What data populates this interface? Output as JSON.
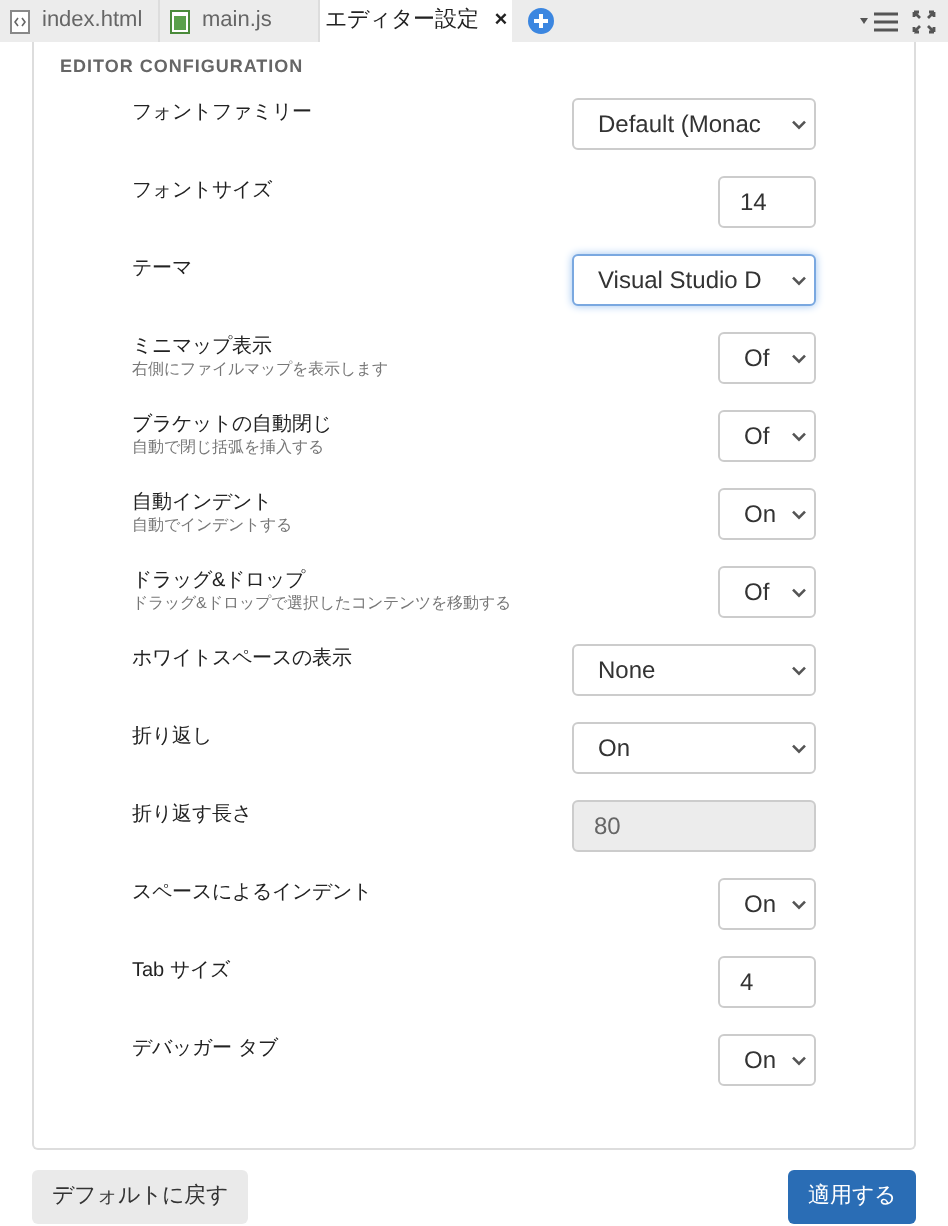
{
  "tabs": [
    {
      "label": "index.html",
      "kind": "html",
      "selected": false
    },
    {
      "label": "main.js",
      "kind": "js",
      "selected": false
    },
    {
      "label": "エディター設定",
      "kind": "settings",
      "selected": true,
      "close": "×"
    }
  ],
  "section_title": "EDITOR CONFIGURATION",
  "settings": [
    {
      "label": "フォントファミリー",
      "kind": "select",
      "value": "Default (Monac"
    },
    {
      "label": "フォントサイズ",
      "kind": "spinner",
      "value": "14"
    },
    {
      "label": "テーマ",
      "kind": "select",
      "value": "Visual Studio D",
      "focused": true
    },
    {
      "label": "ミニマップ表示",
      "description": "右側にファイルマップを表示します",
      "kind": "toggle",
      "value": "Of"
    },
    {
      "label": "ブラケットの自動閉じ",
      "description": "自動で閉じ括弧を挿入する",
      "kind": "toggle",
      "value": "Of"
    },
    {
      "label": "自動インデント",
      "description": "自動でインデントする",
      "kind": "toggle",
      "value": "On"
    },
    {
      "label": "ドラッグ&ドロップ",
      "description": "ドラッグ&ドロップで選択したコンテンツを移動する",
      "kind": "toggle",
      "value": "Of"
    },
    {
      "label": "ホワイトスペースの表示",
      "kind": "select",
      "value": "None"
    },
    {
      "label": "折り返し",
      "kind": "select",
      "value": "On"
    },
    {
      "label": "折り返す長さ",
      "kind": "input",
      "value": "80",
      "disabled": true
    },
    {
      "label": "スペースによるインデント",
      "kind": "toggle",
      "value": "On"
    },
    {
      "label": "Tab サイズ",
      "kind": "spinner",
      "value": "4"
    },
    {
      "label": "デバッガー タブ",
      "kind": "toggle",
      "value": "On"
    }
  ],
  "buttons": [
    {
      "label": "デフォルトに戻す",
      "kind": "secondary"
    },
    {
      "label": "適用する",
      "kind": "primary"
    }
  ]
}
